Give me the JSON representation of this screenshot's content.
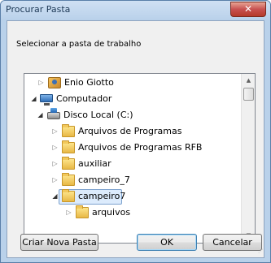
{
  "window": {
    "title": "Procurar Pasta",
    "close_glyph": "✕"
  },
  "prompt": "Selecionar a pasta de trabalho",
  "tree": {
    "items": [
      {
        "label": "Enio Giotto",
        "icon": "user-folder-icon",
        "expanded": false
      },
      {
        "label": "Computador",
        "icon": "computer-icon",
        "expanded": true
      },
      {
        "label": "Disco Local (C:)",
        "icon": "drive-icon",
        "expanded": true
      },
      {
        "label": "Arquivos de Programas",
        "icon": "folder-icon",
        "expanded": false
      },
      {
        "label": "Arquivos de Programas RFB",
        "icon": "folder-icon",
        "expanded": false
      },
      {
        "label": "auxiliar",
        "icon": "folder-icon",
        "expanded": false
      },
      {
        "label": "campeiro_7",
        "icon": "folder-icon",
        "expanded": false
      },
      {
        "label": "campeiro7",
        "icon": "folder-icon",
        "expanded": true,
        "selected": true
      },
      {
        "label": "arquivos",
        "icon": "folder-icon",
        "expanded": false
      }
    ]
  },
  "buttons": {
    "new_folder": "Criar Nova Pasta",
    "ok": "OK",
    "cancel": "Cancelar"
  },
  "glyphs": {
    "collapsed": "▷",
    "expanded": "◢",
    "scroll_up": "▲",
    "scroll_down": "▼",
    "grip": "⋰"
  }
}
